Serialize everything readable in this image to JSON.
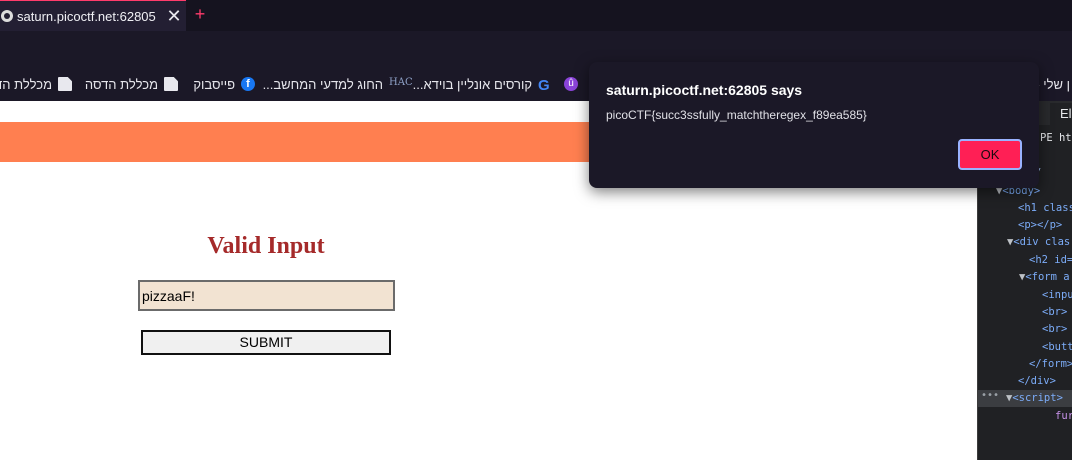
{
  "browser": {
    "tab": {
      "title": "saturn.picoctf.net:62805",
      "close_symbol": "✕"
    },
    "new_tab_symbol": "+",
    "accent_color": "#ff3b6b"
  },
  "bookmarks": [
    {
      "label": "מכללת הדסה",
      "icon": "document-icon"
    },
    {
      "label": "מכללת הדסה",
      "icon": "document-icon"
    },
    {
      "label": "פייסבוק",
      "icon": "facebook-icon",
      "glyph": "f"
    },
    {
      "label": "החוג למדעי המחשב...",
      "icon": "hac-logo-icon",
      "glyph": "HAC"
    },
    {
      "label": "קורסים אונליין בוידא...",
      "icon": "google-icon",
      "glyph": "G"
    },
    {
      "label": "",
      "icon": "udemy-icon",
      "glyph": "û"
    },
    {
      "label": "ן שלי -",
      "icon": ""
    }
  ],
  "page": {
    "banner_color": "#ff7f50",
    "heading": "Valid Input",
    "input_value": "pizzaaF!",
    "submit_label": "SUBMIT"
  },
  "devtools": {
    "elements_tab": "Ele",
    "lines": [
      "PE ht",
      ">⋯</",
      "<body>",
      "<h1 class",
      "<p></p>",
      "<div clas",
      "<h2 id=",
      "<form a",
      "<inpu",
      "<br>",
      "<br>",
      "<butt",
      "</form>",
      "</div>",
      "<script>",
      "fur"
    ]
  },
  "alert": {
    "title": "saturn.picoctf.net:62805 says",
    "message": "picoCTF{succ3ssfully_matchtheregex_f89ea585}",
    "ok_label": "OK"
  }
}
